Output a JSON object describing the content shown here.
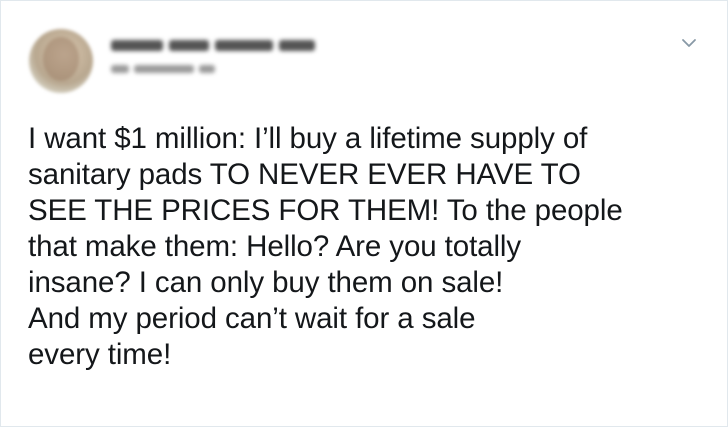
{
  "tweet": {
    "menu_icon": "chevron-down-icon",
    "lines": [
      "I want $1 million: I’ll buy a lifetime supply of",
      "sanitary pads TO NEVER EVER HAVE TO",
      "SEE THE PRICES FOR THEM! To the people",
      "that make them: Hello? Are you totally",
      "insane? I can only buy them on sale!",
      "And my period can’t wait for a sale",
      "every time!"
    ]
  },
  "colors": {
    "text": "#14171a",
    "border": "#e1e8ed",
    "icon": "#8899a6"
  }
}
